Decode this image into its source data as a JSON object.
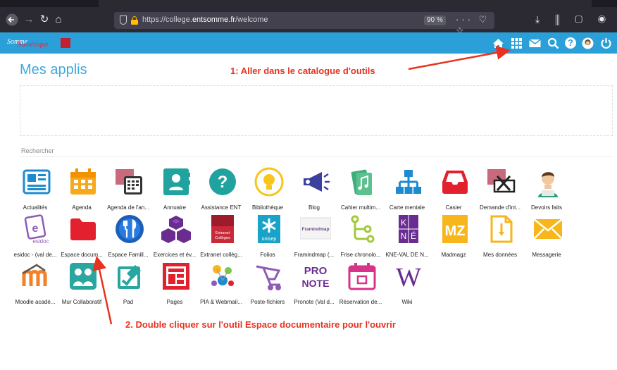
{
  "browser": {
    "url_prefix": "https://college.",
    "url_domain": "entsomme.fr",
    "url_path": "/welcome",
    "zoom": "90 %",
    "nav_icons": [
      "back-icon",
      "forward-icon",
      "reload-icon",
      "home-icon"
    ],
    "url_icons": "··· ♡ ☆",
    "toolbar_icons": "⤓ ⫼ ▢ ◉ ⇢"
  },
  "header": {
    "logo_text_1": "Somme",
    "logo_text_2": "Numérique",
    "icons": [
      "home-icon",
      "apps-grid-icon",
      "mail-icon",
      "search-icon",
      "help-icon",
      "avatar-icon",
      "power-icon"
    ],
    "accent": "#2a9fd8"
  },
  "page": {
    "title": "Mes applis",
    "search_label": "Rechercher"
  },
  "annotations": {
    "step1": "1: Aller dans le catalogue d'outils",
    "step2": "2. Double cliquer sur l'outil Espace documentaire pour l'ouvrir",
    "color": "#e8321f"
  },
  "apps": [
    {
      "label": "Actualités",
      "icon": "newspaper-icon"
    },
    {
      "label": "Agenda",
      "icon": "calendar-icon"
    },
    {
      "label": "Agenda de l'an...",
      "icon": "agenda-annee-icon"
    },
    {
      "label": "Annuaire",
      "icon": "contact-book-icon"
    },
    {
      "label": "Assistance ENT",
      "icon": "help-circle-icon"
    },
    {
      "label": "Bibliothèque",
      "icon": "lightbulb-icon"
    },
    {
      "label": "Blog",
      "icon": "megaphone-icon"
    },
    {
      "label": "Cahier multim...",
      "icon": "music-notebook-icon"
    },
    {
      "label": "Carte mentale",
      "icon": "sitemap-icon"
    },
    {
      "label": "Casier",
      "icon": "inbox-tray-icon"
    },
    {
      "label": "Demande d'int...",
      "icon": "printer-broken-icon"
    },
    {
      "label": "Devoirs faits",
      "icon": "student-avatar-icon"
    },
    {
      "label": "esidoc - (val de...",
      "icon": "esidoc-icon",
      "badge": "esidoc"
    },
    {
      "label": "Espace docum...",
      "icon": "folder-icon"
    },
    {
      "label": "Espace Famill...",
      "icon": "family-fork-icon"
    },
    {
      "label": "Exercices et év...",
      "icon": "cubes-icon"
    },
    {
      "label": "Extranet collèg...",
      "icon": "extranet-icon",
      "badge": "Extranet Collèges"
    },
    {
      "label": "Folios",
      "icon": "folios-icon",
      "badge": "onisep"
    },
    {
      "label": "Framindmap (...",
      "icon": "framindmap-icon",
      "badge": "Framindmap"
    },
    {
      "label": "Frise chronolo...",
      "icon": "timeline-icon"
    },
    {
      "label": "KNE-VAL DE N...",
      "icon": "kne-icon",
      "badge": "K N É"
    },
    {
      "label": "Madmagz",
      "icon": "madmagz-icon",
      "badge": "MZ"
    },
    {
      "label": "Mes données",
      "icon": "data-file-icon"
    },
    {
      "label": "Messagerie",
      "icon": "envelope-icon"
    },
    {
      "label": "Moodle acadé...",
      "icon": "moodle-icon"
    },
    {
      "label": "Mur Collaboratif",
      "icon": "collab-wall-icon"
    },
    {
      "label": "Pad",
      "icon": "pad-icon"
    },
    {
      "label": "Pages",
      "icon": "pages-icon"
    },
    {
      "label": "PIA & Webmail...",
      "icon": "pia-webmail-icon"
    },
    {
      "label": "Poste-fichiers",
      "icon": "cart-files-icon"
    },
    {
      "label": "Pronote (Val d...",
      "icon": "pronote-icon",
      "badge": "PRO NOTE"
    },
    {
      "label": "Réservation de...",
      "icon": "booking-calendar-icon"
    },
    {
      "label": "Wiki",
      "icon": "wiki-w-icon",
      "badge": "W"
    }
  ]
}
